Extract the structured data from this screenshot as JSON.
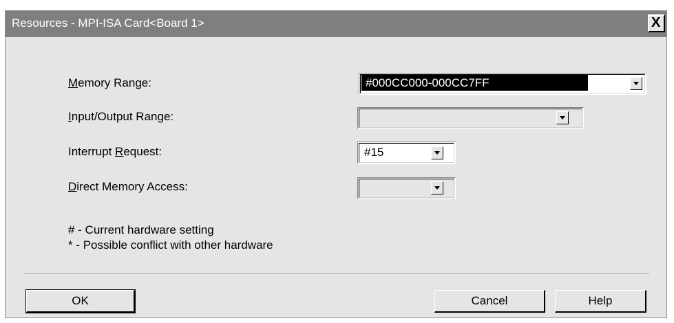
{
  "window": {
    "title": "Resources - MPI-ISA Card<Board 1>",
    "close_label": "X"
  },
  "fields": {
    "memory_range": {
      "label_mnemonic": "M",
      "label_rest": "emory Range:",
      "value": "#000CC000-000CC7FF"
    },
    "io_range": {
      "label_mnemonic": "I",
      "label_rest": "nput/Output Range:",
      "value": ""
    },
    "irq": {
      "label_pre": "Interrupt ",
      "label_mnemonic": "R",
      "label_rest": "equest:",
      "value": "#15"
    },
    "dma": {
      "label_mnemonic": "D",
      "label_rest": "irect Memory Access:",
      "value": ""
    }
  },
  "legend": {
    "line1": "# -  Current hardware setting",
    "line2": "* -  Possible conflict with other hardware"
  },
  "buttons": {
    "ok": "OK",
    "cancel": "Cancel",
    "help": "Help"
  },
  "icons": {
    "close": "close-icon",
    "dropdown": "chevron-down-icon"
  }
}
